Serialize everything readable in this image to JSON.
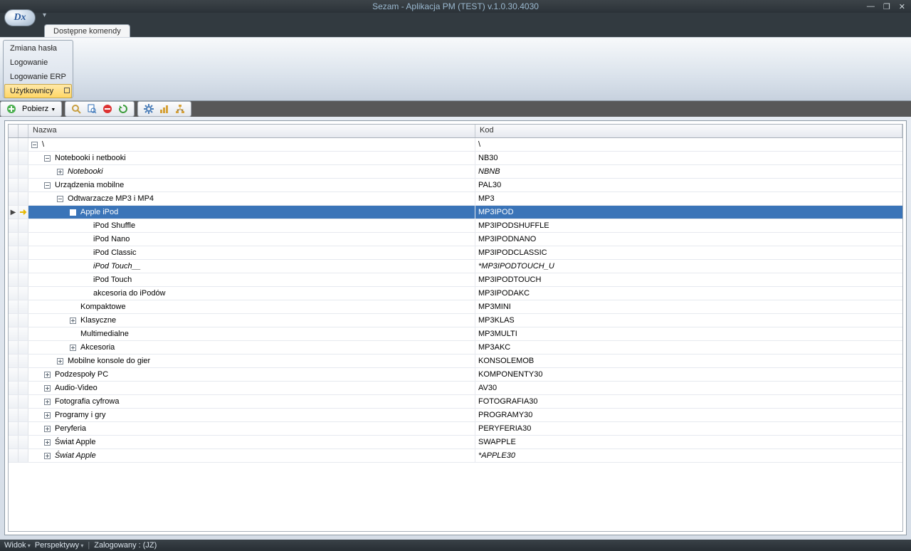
{
  "window": {
    "title": "Sezam - Aplikacja PM (TEST) v.1.0.30.4030"
  },
  "tab": {
    "label": "Dostępne komendy"
  },
  "ribbon": {
    "items": [
      {
        "label": "Zmiana hasła"
      },
      {
        "label": "Logowanie"
      },
      {
        "label": "Logowanie ERP"
      },
      {
        "label": "Użytkownicy"
      }
    ]
  },
  "toolbar": {
    "fetch": "Pobierz"
  },
  "grid": {
    "columns": {
      "name": "Nazwa",
      "code": "Kod"
    },
    "rows": [
      {
        "depth": 0,
        "exp": "minus",
        "name": "\\",
        "code": "\\"
      },
      {
        "depth": 1,
        "exp": "minus",
        "name": "Notebooki i netbooki",
        "code": "NB30"
      },
      {
        "depth": 2,
        "exp": "plus",
        "name": "Notebooki",
        "code": "NBNB",
        "italic": true
      },
      {
        "depth": 1,
        "exp": "minus",
        "name": "Urządzenia mobilne",
        "code": "PAL30"
      },
      {
        "depth": 2,
        "exp": "minus",
        "name": "Odtwarzacze MP3 i MP4",
        "code": "MP3"
      },
      {
        "depth": 3,
        "exp": "minus",
        "name": "Apple iPod",
        "code": "MP3IPOD",
        "selected": true,
        "pointer": true
      },
      {
        "depth": 4,
        "exp": "",
        "name": "iPod Shuffle",
        "code": "MP3IPODSHUFFLE"
      },
      {
        "depth": 4,
        "exp": "",
        "name": "iPod Nano",
        "code": "MP3IPODNANO"
      },
      {
        "depth": 4,
        "exp": "",
        "name": "iPod Classic",
        "code": "MP3IPODCLASSIC"
      },
      {
        "depth": 4,
        "exp": "",
        "name": "iPod Touch__",
        "code": "*MP3IPODTOUCH_U",
        "italic": true
      },
      {
        "depth": 4,
        "exp": "",
        "name": "iPod Touch",
        "code": "MP3IPODTOUCH"
      },
      {
        "depth": 4,
        "exp": "",
        "name": "akcesoria do iPodów",
        "code": "MP3IPODAKC"
      },
      {
        "depth": 3,
        "exp": "",
        "name": "Kompaktowe",
        "code": "MP3MINI"
      },
      {
        "depth": 3,
        "exp": "plus",
        "name": "Klasyczne",
        "code": "MP3KLAS"
      },
      {
        "depth": 3,
        "exp": "",
        "name": "Multimedialne",
        "code": "MP3MULTI"
      },
      {
        "depth": 3,
        "exp": "plus",
        "name": "Akcesoria",
        "code": "MP3AKC"
      },
      {
        "depth": 2,
        "exp": "plus",
        "name": "Mobilne konsole do gier",
        "code": "KONSOLEMOB"
      },
      {
        "depth": 1,
        "exp": "plus",
        "name": "Podzespoły PC",
        "code": "KOMPONENTY30"
      },
      {
        "depth": 1,
        "exp": "plus",
        "name": "Audio-Video",
        "code": "AV30"
      },
      {
        "depth": 1,
        "exp": "plus",
        "name": "Fotografia cyfrowa",
        "code": "FOTOGRAFIA30"
      },
      {
        "depth": 1,
        "exp": "plus",
        "name": "Programy i gry",
        "code": "PROGRAMY30"
      },
      {
        "depth": 1,
        "exp": "plus",
        "name": "Peryferia",
        "code": "PERYFERIA30"
      },
      {
        "depth": 1,
        "exp": "plus",
        "name": "Świat Apple",
        "code": "SWAPPLE"
      },
      {
        "depth": 1,
        "exp": "plus",
        "name": "Świat Apple",
        "code": "*APPLE30",
        "italic": true
      }
    ]
  },
  "statusbar": {
    "view": "Widok",
    "persp": "Perspektywy",
    "user": "Zalogowany : (JZ)"
  },
  "icons": {
    "add": "add-icon",
    "search": "magnify-icon",
    "doc-search": "doc-search-icon",
    "delete": "delete-icon",
    "refresh": "refresh-icon",
    "gear": "gear-icon",
    "chart1": "chart-icon",
    "chart2": "tree-icon"
  }
}
